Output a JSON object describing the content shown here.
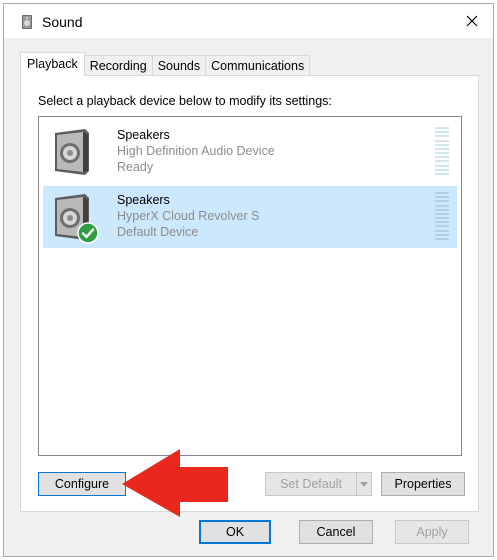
{
  "window": {
    "title": "Sound",
    "icon": "speaker-icon",
    "close_icon": "close-icon"
  },
  "tabs": [
    {
      "label": "Playback",
      "active": true
    },
    {
      "label": "Recording",
      "active": false
    },
    {
      "label": "Sounds",
      "active": false
    },
    {
      "label": "Communications",
      "active": false
    }
  ],
  "instruction": "Select a playback device below to modify its settings:",
  "devices": [
    {
      "name": "Speakers",
      "description": "High Definition Audio Device",
      "status": "Ready",
      "selected": false,
      "is_default": false
    },
    {
      "name": "Speakers",
      "description": "HyperX Cloud Revolver S",
      "status": "Default Device",
      "selected": true,
      "is_default": true
    }
  ],
  "buttons": {
    "configure": "Configure",
    "set_default": "Set Default",
    "properties": "Properties",
    "ok": "OK",
    "cancel": "Cancel",
    "apply": "Apply"
  },
  "colors": {
    "selection": "#cce8ff",
    "accent": "#0078d7",
    "default_check": "#2ea043",
    "annotation_arrow": "#e8281c"
  }
}
